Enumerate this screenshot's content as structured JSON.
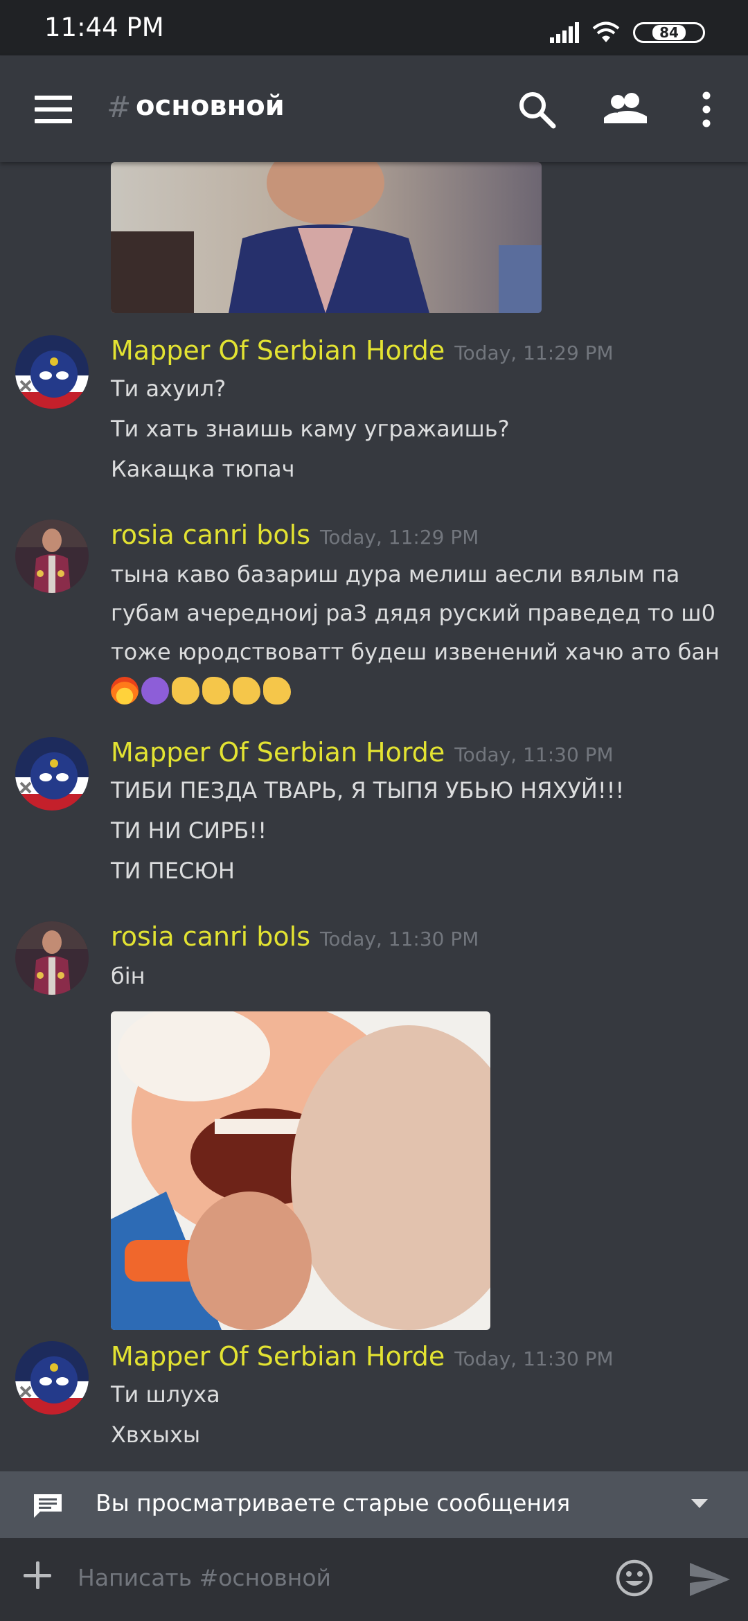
{
  "status_bar": {
    "time": "11:44 PM",
    "battery": "84"
  },
  "header": {
    "hash": "#",
    "channel_name": "основной"
  },
  "messages": [
    {
      "author": "Mapper Of Serbian Horde",
      "timestamp": "Today, 11:29 PM",
      "lines": [
        "Ти ахуил?",
        "Ти хать знаишь каму угражаишь?",
        "Какащка тюпач"
      ]
    },
    {
      "author": "rosia canri bols",
      "timestamp": "Today, 11:29 PM",
      "lines": [
        "тына каво базариш дура мелиш аесли вялым па",
        "губам ачередноиј ра3 дядя руский праведед то ш0",
        "тоже юродствоватт будеш извенений хачю ато бан"
      ],
      "emojis": [
        "fire",
        "smiling-imp",
        "call-me-hand",
        "call-me-hand",
        "call-me-hand",
        "call-me-hand"
      ]
    },
    {
      "author": "Mapper Of Serbian Horde",
      "timestamp": "Today, 11:30 PM",
      "lines": [
        "ТИБИ ПЕЗДА ТВАРЬ, Я ТЫПЯ УБЬЮ НЯХУЙ!!!",
        "ТИ НИ СИРБ!!",
        "ТИ ПЕСЮН"
      ]
    },
    {
      "author": "rosia canri bols",
      "timestamp": "Today, 11:30 PM",
      "lines": [
        "бін"
      ]
    },
    {
      "author": "Mapper Of Serbian Horde",
      "timestamp": "Today, 11:30 PM",
      "lines": [
        "Ти шлуха",
        "Хвхыхы"
      ]
    }
  ],
  "old_messages_bar": {
    "text": "Вы просматриваете старые сообщения"
  },
  "composer": {
    "placeholder": "Написать #основной"
  },
  "colors": {
    "background": "#36393f",
    "username": "#e3e332",
    "timestamp": "#72767d",
    "composer": "#2f3136",
    "old_bar": "#4f545c"
  }
}
